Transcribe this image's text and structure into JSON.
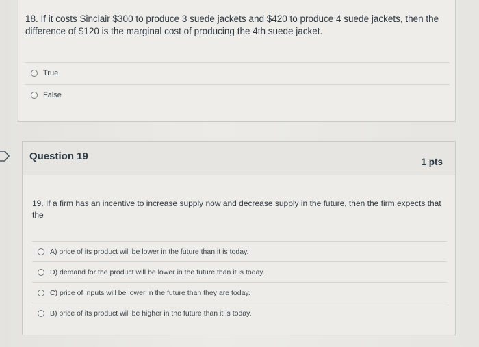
{
  "q18": {
    "text": "18. If it costs Sinclair $300 to produce 3 suede jackets and $420 to produce 4 suede jackets, then the difference of $120 is the marginal cost of producing the 4th suede jacket.",
    "answers": [
      {
        "label": "True"
      },
      {
        "label": "False"
      }
    ]
  },
  "q19": {
    "title": "Question 19",
    "points": "1 pts",
    "text": "19. If a firm has an incentive to increase supply now and decrease supply in the future, then the firm expects that the",
    "answers": [
      {
        "label": "A) price of its product will be lower in the future than it is today."
      },
      {
        "label": "D) demand for the product will be lower in the future than it is today."
      },
      {
        "label": "C) price of inputs will be lower in the future than they are today."
      },
      {
        "label": "B) price of its product will be higher in the future than it is today."
      }
    ]
  },
  "colors": {
    "text": "#2d3b45",
    "card_bg": "#edece8",
    "border": "#c9c8c3"
  }
}
